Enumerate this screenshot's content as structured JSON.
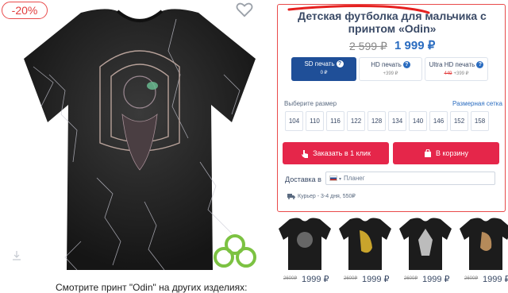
{
  "image": {
    "discount": "-20%",
    "fav_icon": "heart-outline-icon",
    "download_icon": "download-icon",
    "brand_logo": "green-clover-logo-icon"
  },
  "caption": "Смотрите принт \"Odin\" на других изделиях:",
  "product": {
    "title": "Детская футболка для мальчика с принтом «Odin»",
    "old_price": "2 599 ₽",
    "new_price": "1 999 ₽"
  },
  "print_options": [
    {
      "name": "SD печать",
      "price": "0 ₽",
      "selected": true
    },
    {
      "name": "HD печать",
      "price": "+399 ₽",
      "selected": false
    },
    {
      "name": "Ultra HD печать",
      "old_price": "449",
      "price": "+399 ₽",
      "selected": false
    }
  ],
  "print_help": "?",
  "sizes": {
    "label": "Выберите размер",
    "chart_link": "Размерная сетка",
    "options": [
      "104",
      "110",
      "116",
      "122",
      "128",
      "134",
      "140",
      "146",
      "152",
      "158"
    ]
  },
  "buttons": {
    "one_click": "Заказать в 1 клик",
    "one_click_icon": "hand-pointer-icon",
    "cart": "В корзину",
    "cart_icon": "shopping-bag-icon"
  },
  "delivery": {
    "label": "Доставка в",
    "caret": "▾",
    "location": "Планег",
    "courier": "Курьер - 3-4 дня, 550₽",
    "courier_icon": "truck-icon"
  },
  "related": [
    {
      "old_price": "2600₽",
      "new_price": "1999 ₽"
    },
    {
      "old_price": "2600₽",
      "new_price": "1999 ₽"
    },
    {
      "old_price": "2600₽",
      "new_price": "1999 ₽"
    },
    {
      "old_price": "2600₽",
      "new_price": "1999 ₽"
    }
  ],
  "colors": {
    "accent_red": "#e5264a",
    "price_blue": "#2a6cc0",
    "selected_blue": "#1f4f98",
    "brand_green": "#7cc242"
  }
}
